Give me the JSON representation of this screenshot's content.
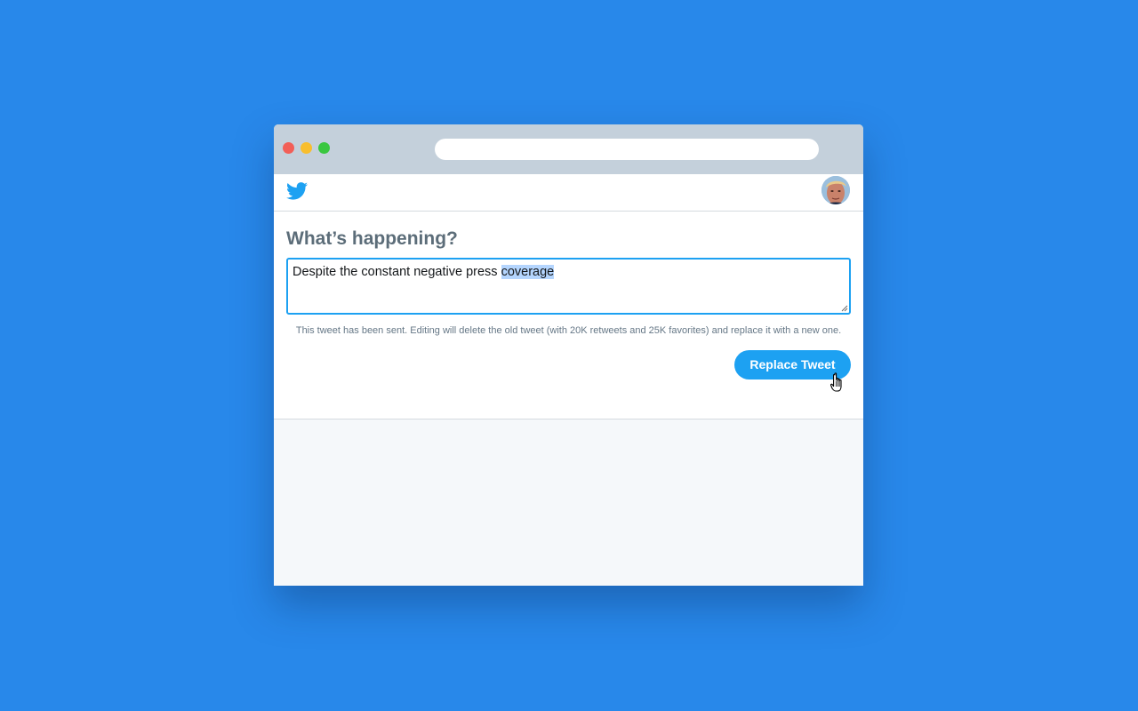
{
  "icons": {
    "traffic_lights": [
      "close-dot-icon",
      "minimize-dot-icon",
      "maximize-dot-icon"
    ],
    "logo": "twitter-bird-icon",
    "avatar": "user-avatar",
    "cursor": "hand-pointer-icon"
  },
  "colors": {
    "background": "#2888EA",
    "brand": "#1DA1F2",
    "heading": "#5C6D79",
    "selection": "#B4D5FE"
  },
  "browser": {
    "url": ""
  },
  "compose": {
    "heading": "What’s happening?",
    "text_before_selection": "Despite the constant negative press ",
    "text_selected": "coverage",
    "notice": "This tweet has been sent. Editing will delete the old tweet (with 20K retweets and 25K favorites) and replace it with a new one.",
    "button_label": "Replace Tweet"
  }
}
